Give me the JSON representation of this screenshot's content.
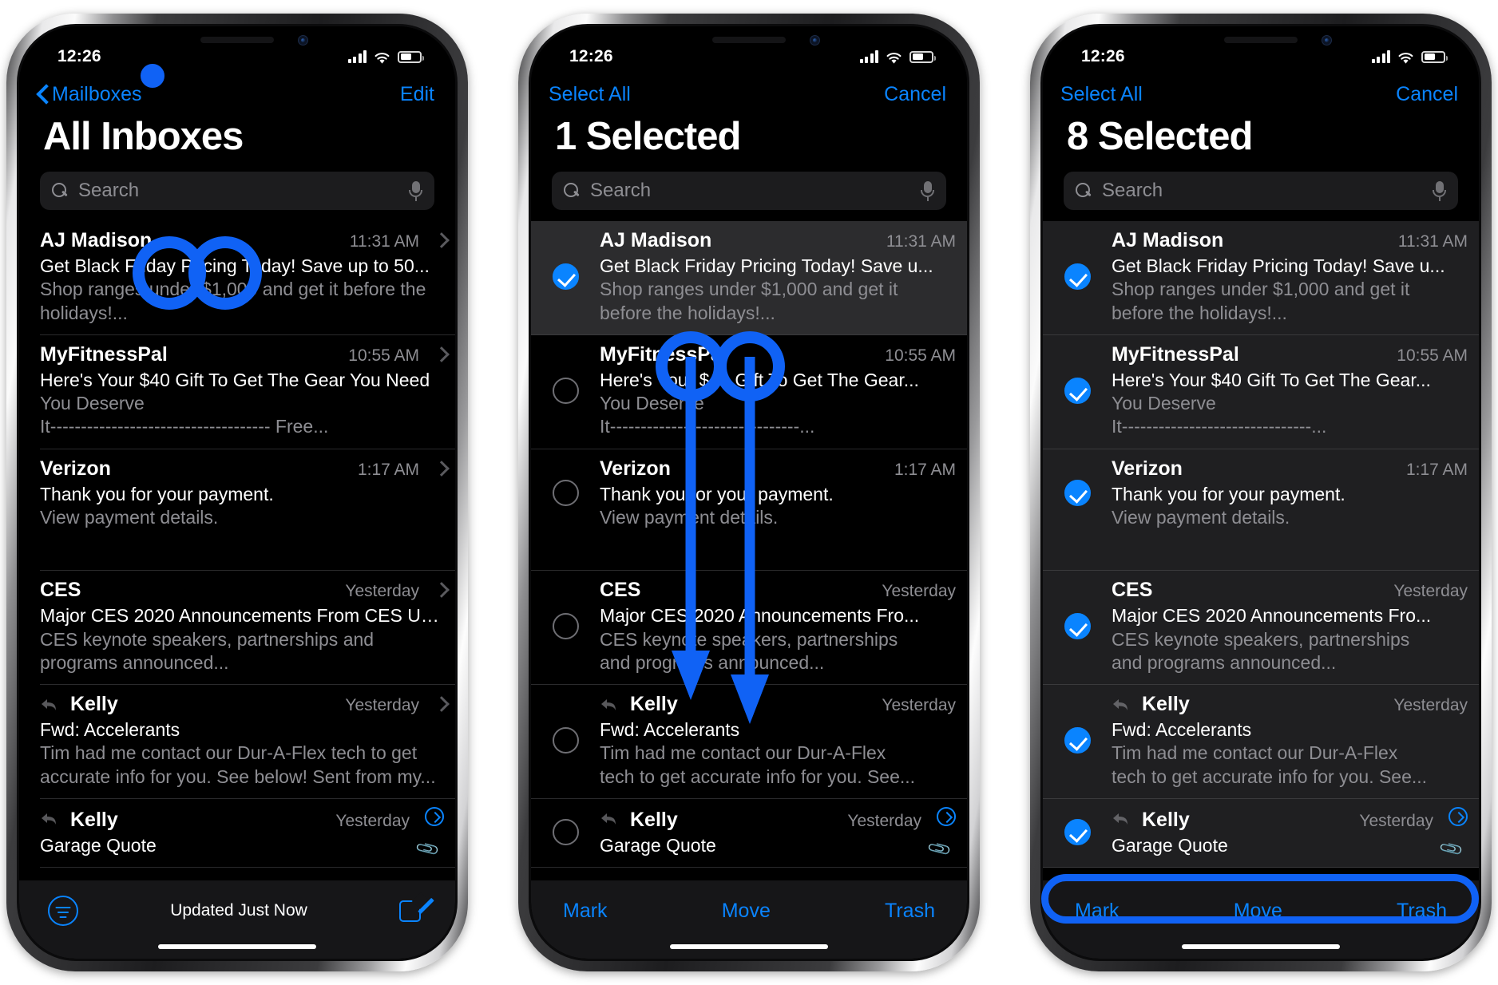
{
  "status": {
    "time": "12:26",
    "icons": [
      "cellular-signal-icon",
      "wifi-icon",
      "battery-icon"
    ]
  },
  "phones": [
    {
      "id": "phone-inbox",
      "nav": {
        "back_label": "Mailboxes",
        "right_label": "Edit",
        "left_label": ""
      },
      "title": "All Inboxes",
      "search": {
        "placeholder": "Search",
        "mic": "microphone-icon"
      },
      "mode": "browse",
      "toolbar": {
        "filter": "filter-icon",
        "status": "Updated Just Now",
        "compose": "compose-icon"
      }
    },
    {
      "id": "phone-one-selected",
      "nav": {
        "left_label": "Select All",
        "right_label": "Cancel",
        "back_label": ""
      },
      "title": "1 Selected",
      "search": {
        "placeholder": "Search",
        "mic": "microphone-icon"
      },
      "mode": "edit",
      "toolbar": {
        "mark": "Mark",
        "move": "Move",
        "trash": "Trash"
      }
    },
    {
      "id": "phone-eight-selected",
      "nav": {
        "left_label": "Select All",
        "right_label": "Cancel",
        "back_label": ""
      },
      "title": "8 Selected",
      "search": {
        "placeholder": "Search",
        "mic": "microphone-icon"
      },
      "mode": "edit",
      "toolbar": {
        "mark": "Mark",
        "move": "Move",
        "trash": "Trash"
      }
    }
  ],
  "emails": [
    {
      "sender": "AJ Madison",
      "time": "11:31 AM",
      "subject": "Get Black Friday Pricing Today! Save up to 50...",
      "subject_short": "Get Black Friday Pricing Today! Save u...",
      "preview_line1": "Shop ranges under $1,000 and get it before the",
      "preview_line2": "holidays!...",
      "preview_alt1": "Shop ranges under $1,000 and get it",
      "preview_alt2": "before the holidays!...",
      "reply": false,
      "attachment": false,
      "selected_p2": true,
      "selected_p3": true
    },
    {
      "sender": "MyFitnessPal",
      "time": "10:55 AM",
      "subject": "Here's Your $40 Gift To Get The Gear You Need",
      "subject_short": "Here's Your $40 Gift To Get The Gear...",
      "preview_line1": "You Deserve",
      "preview_line2": "It------------------------------------ Free...",
      "preview_alt1": "You Deserve",
      "preview_alt2": "It-------------------------------...",
      "reply": false,
      "attachment": false,
      "selected_p2": false,
      "selected_p3": true
    },
    {
      "sender": "Verizon",
      "time": "1:17 AM",
      "subject": "Thank you for your payment.",
      "subject_short": "Thank you for your payment.",
      "preview_line1": "View payment details.",
      "preview_line2": "",
      "preview_alt1": "View payment details.",
      "preview_alt2": "",
      "reply": false,
      "attachment": false,
      "selected_p2": false,
      "selected_p3": true
    },
    {
      "sender": "CES",
      "time": "Yesterday",
      "subject": "Major CES 2020 Announcements From CES Un...",
      "subject_short": "Major CES 2020 Announcements Fro...",
      "preview_line1": "CES keynote speakers, partnerships and",
      "preview_line2": "programs announced...",
      "preview_alt1": "CES keynote speakers, partnerships",
      "preview_alt2": "and programs announced...",
      "reply": false,
      "attachment": false,
      "selected_p2": false,
      "selected_p3": true
    },
    {
      "sender": "Kelly",
      "time": "Yesterday",
      "subject": "Fwd: Accelerants",
      "subject_short": "Fwd: Accelerants",
      "preview_line1": "Tim had me contact our Dur-A-Flex tech to get",
      "preview_line2": "accurate info for you. See below! Sent from my...",
      "preview_alt1": "Tim had me contact our Dur-A-Flex",
      "preview_alt2": "tech to get accurate info for you. See...",
      "reply": true,
      "attachment": false,
      "selected_p2": false,
      "selected_p3": true
    },
    {
      "sender": "Kelly",
      "time": "Yesterday",
      "subject": "Garage Quote",
      "subject_short": "Garage Quote",
      "preview_line1": "",
      "preview_line2": "",
      "preview_alt1": "",
      "preview_alt2": "",
      "reply": true,
      "attachment": true,
      "selected_p2": false,
      "selected_p3": true
    }
  ],
  "annotations": {
    "accent_color": "#1062f5",
    "shapes": [
      {
        "kind": "circle",
        "target": "phone1-aj-madison-subject-left"
      },
      {
        "kind": "circle",
        "target": "phone1-aj-madison-subject-right"
      },
      {
        "kind": "circle",
        "target": "phone2-myfitnesspal-subject-left"
      },
      {
        "kind": "circle",
        "target": "phone2-myfitnesspal-subject-right"
      },
      {
        "kind": "arrow",
        "target": "phone2-drag-down-left"
      },
      {
        "kind": "arrow",
        "target": "phone2-drag-down-right"
      },
      {
        "kind": "rounded-rect",
        "target": "phone3-bottom-toolbar"
      }
    ]
  }
}
